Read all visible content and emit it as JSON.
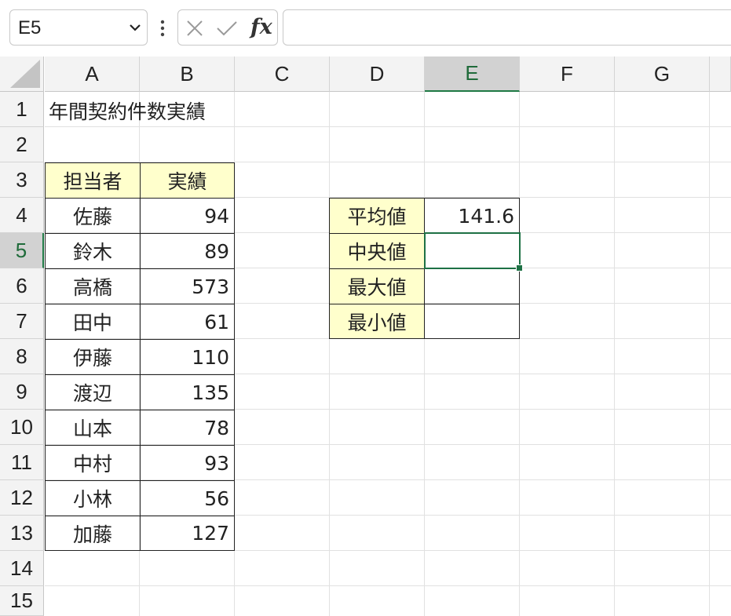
{
  "formula_bar": {
    "name_box": "E5",
    "formula": ""
  },
  "columns": [
    "A",
    "B",
    "C",
    "D",
    "E",
    "F",
    "G"
  ],
  "active_column": "E",
  "rows": [
    "1",
    "2",
    "3",
    "4",
    "5",
    "6",
    "7",
    "8",
    "9",
    "10",
    "11",
    "12",
    "13",
    "14",
    "15"
  ],
  "active_row": "5",
  "title": "年間契約件数実績",
  "table": {
    "headers": [
      "担当者",
      "実績"
    ],
    "rows": [
      [
        "佐藤",
        "94"
      ],
      [
        "鈴木",
        "89"
      ],
      [
        "高橋",
        "573"
      ],
      [
        "田中",
        "61"
      ],
      [
        "伊藤",
        "110"
      ],
      [
        "渡辺",
        "135"
      ],
      [
        "山本",
        "78"
      ],
      [
        "中村",
        "93"
      ],
      [
        "小林",
        "56"
      ],
      [
        "加藤",
        "127"
      ]
    ]
  },
  "stats": [
    {
      "label": "平均値",
      "value": "141.6"
    },
    {
      "label": "中央値",
      "value": ""
    },
    {
      "label": "最大値",
      "value": ""
    },
    {
      "label": "最小値",
      "value": ""
    }
  ],
  "colors": {
    "header_fill": "#ffffcc",
    "selection": "#1e7145"
  }
}
